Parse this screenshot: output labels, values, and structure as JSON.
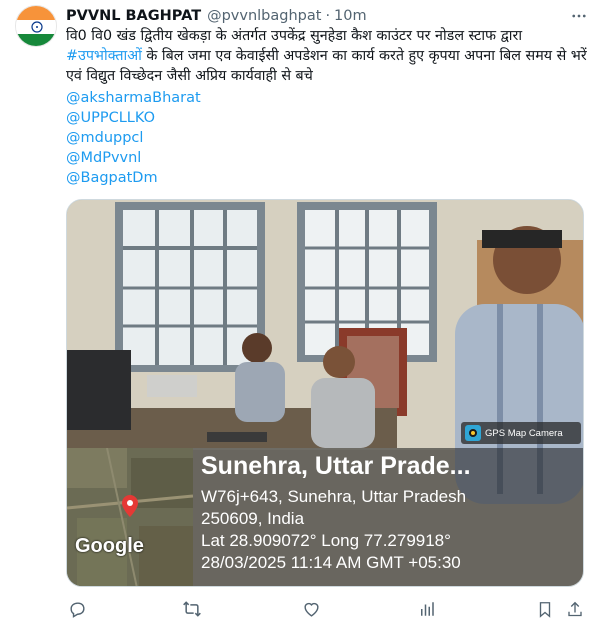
{
  "account": {
    "name": "PVVNL BAGHPAT",
    "handle": "@pvvnlbaghpat",
    "separator": "·",
    "time": "10m"
  },
  "post": {
    "text_before": "वि0 वि0 खंड द्वितीय खेकड़ा के अंतर्गत उपकेंद्र सुनहेडा कैश काउंटर पर नोडल स्टाफ द्वारा ",
    "hashtag": "#उपभोक्ताओं",
    "text_after": " के बिल जमा एव केवाईसी अपडेशन का कार्य करते हुए कृपया अपना बिल समय से भरें एवं विद्युत विच्छेदन जैसी अप्रिय कार्यवाही से बचे",
    "mentions": [
      "@aksharmaBharat",
      "@UPPCLLKO",
      "@mduppcl",
      "@MdPvvnl",
      "@BagpatDm"
    ]
  },
  "media": {
    "gps_badge": "GPS Map Camera",
    "map_brand": "Google",
    "location_title": "Sunehra, Uttar Prade...",
    "address_line1": "W76j+643, Sunehra, Uttar Pradesh",
    "address_line2": "250609, India",
    "coords": "Lat 28.909072° Long 77.279918°",
    "datetime": "28/03/2025 11:14 AM GMT +05:30"
  },
  "icons": {
    "more": "more-dots-icon",
    "reply": "reply-icon",
    "repost": "repost-icon",
    "like": "like-icon",
    "views": "views-icon",
    "bookmark": "bookmark-icon",
    "share": "share-icon"
  },
  "colors": {
    "link": "#1d9bf0",
    "muted": "#536471",
    "text": "#0f1419"
  }
}
